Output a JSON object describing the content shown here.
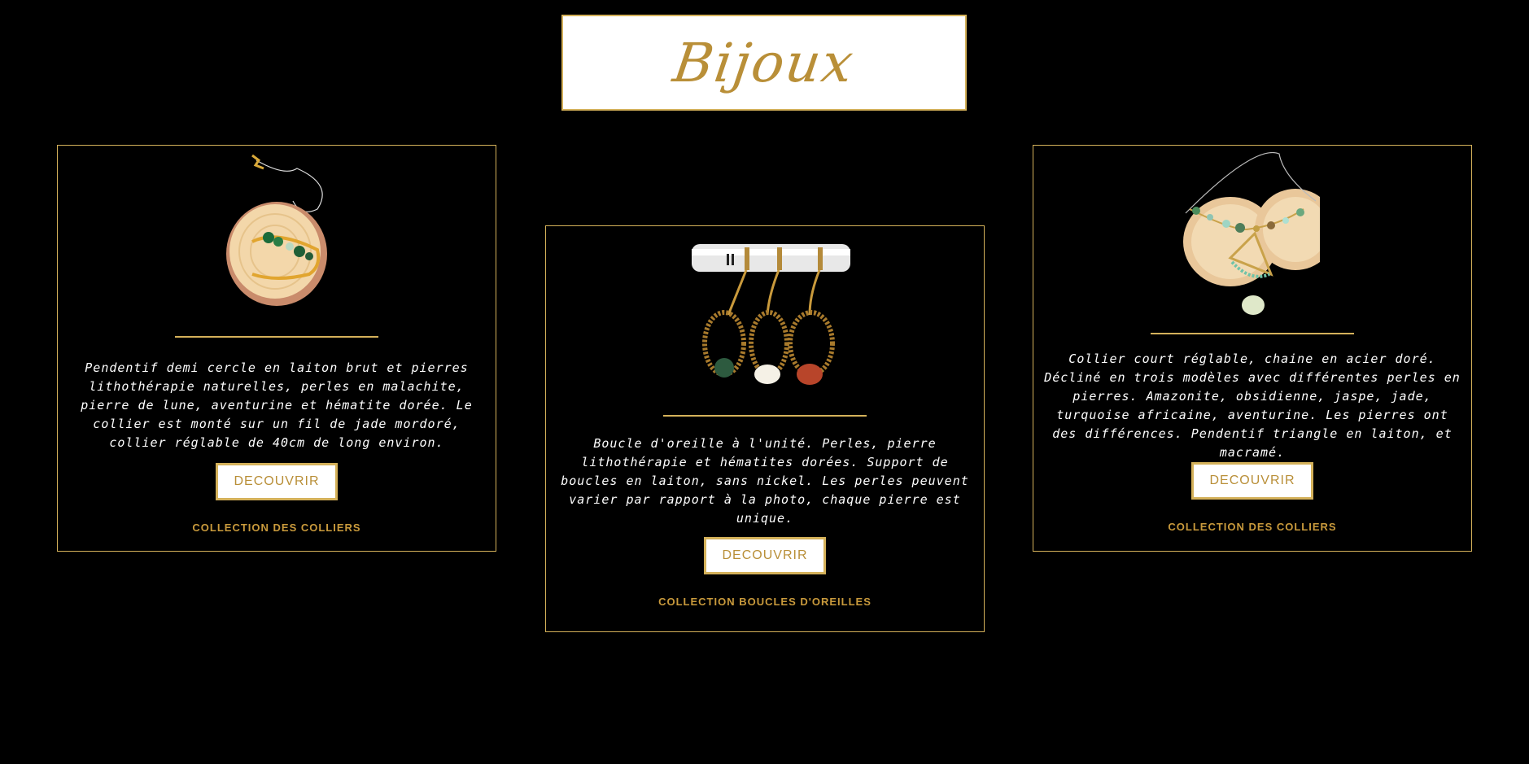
{
  "header": {
    "title": "Bijoux"
  },
  "colors": {
    "accent": "#d4b15a",
    "text_gold": "#b98f38",
    "background": "#000000"
  },
  "cards": [
    {
      "image": "pendant-on-wood-slice",
      "description": "Pendentif demi cercle en laiton brut et pierres lithothérapie naturelles, perles en malachite, pierre de lune, aventurine et hématite dorée. Le collier est monté sur un fil de jade mordoré, collier réglable de 40cm de long environ.",
      "button_label": "DECOUVRIR",
      "collection_label": "COLLECTION DES COLLIERS"
    },
    {
      "image": "three-earrings-on-rod",
      "description": "Boucle d'oreille à l'unité. Perles, pierre lithothérapie et hématites dorées. Support de boucles en laiton, sans nickel. Les perles peuvent varier par rapport à la photo, chaque pierre est unique.",
      "button_label": "DECOUVRIR",
      "collection_label": "COLLECTION BOUCLES D'OREILLES"
    },
    {
      "image": "necklace-on-wood-slices",
      "description": "Collier court réglable, chaine en acier doré. Décliné en trois modèles avec différentes perles en pierres. Amazonite, obsidienne, jaspe, jade, turquoise africaine, aventurine. Les pierres ont des différences. Pendentif triangle en laiton, et macramé.",
      "button_label": "DECOUVRIR",
      "collection_label": "COLLECTION DES COLLIERS"
    }
  ]
}
